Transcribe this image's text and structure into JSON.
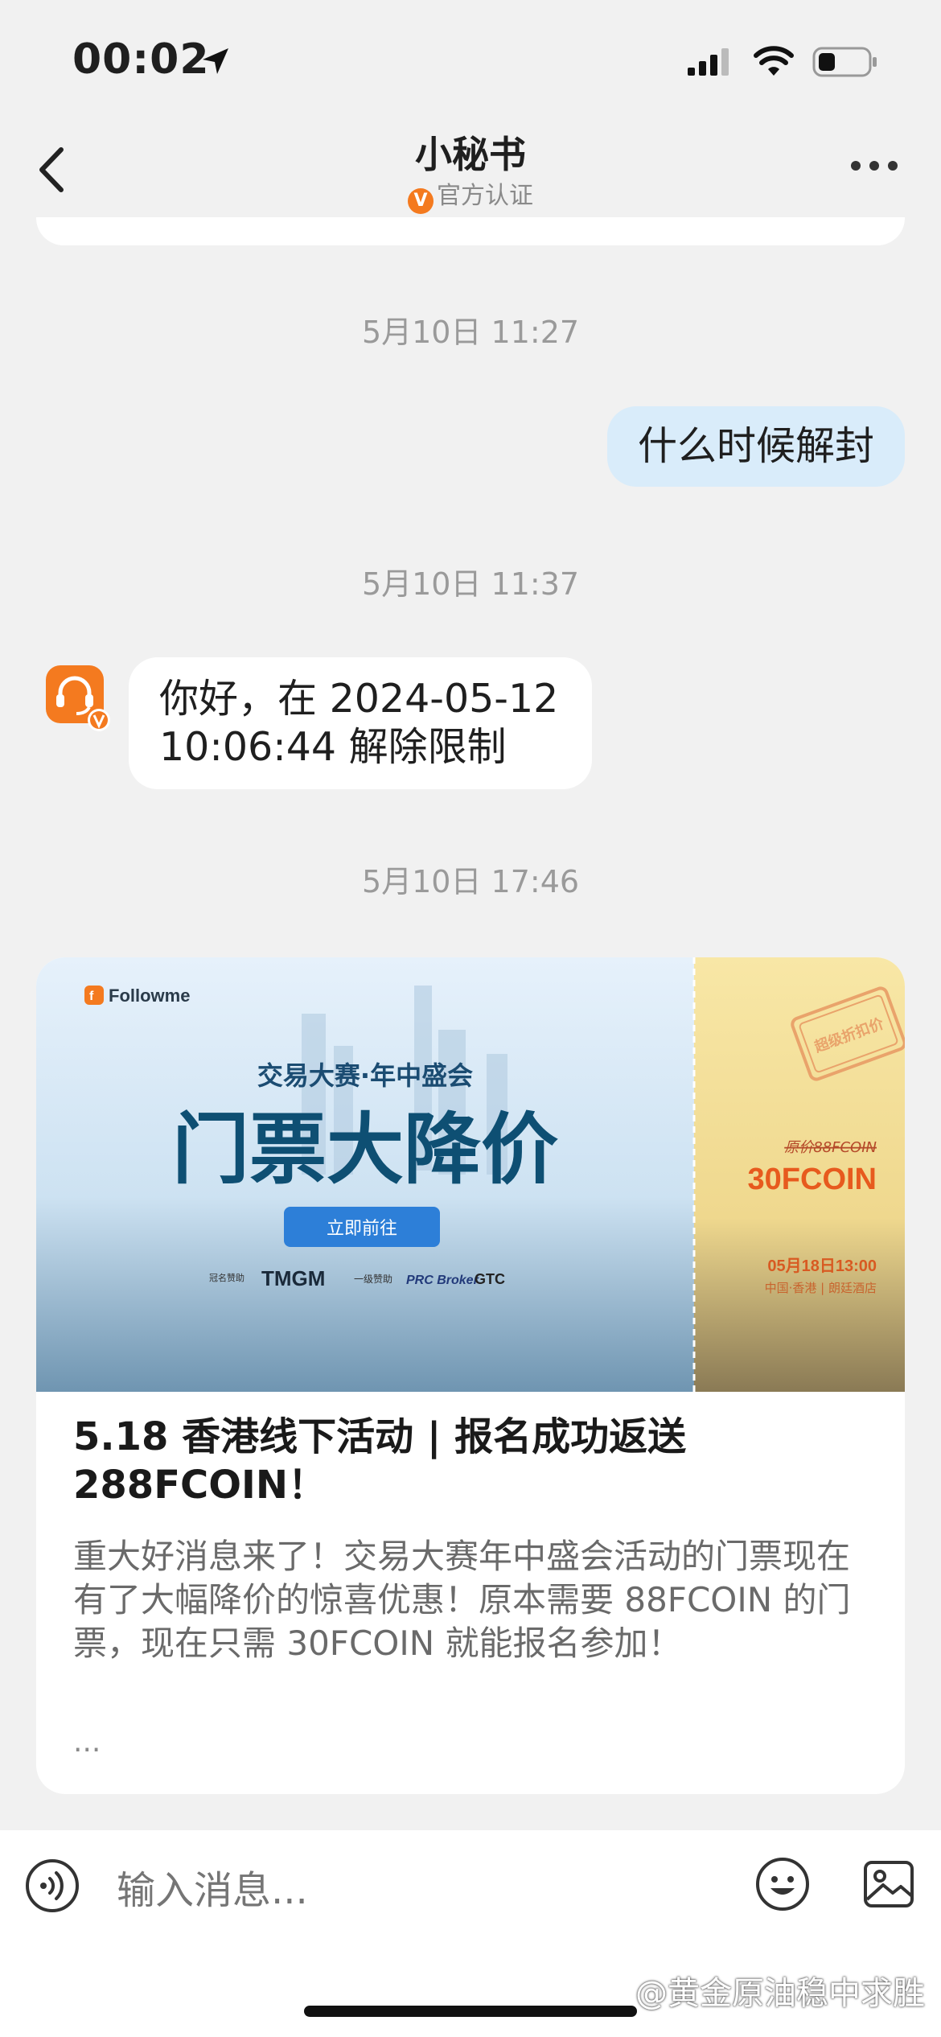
{
  "status_bar": {
    "time": "00:02"
  },
  "nav": {
    "title": "小秘书",
    "verification": "官方认证",
    "verify_badge": "V"
  },
  "chat": {
    "messages": [
      {
        "timestamp": "5月10日 11:27",
        "text": "什么时候解封",
        "direction": "outgoing"
      },
      {
        "timestamp": "5月10日 11:37",
        "text": "你好，在 2024-05-12 10:06:44 解除限制",
        "direction": "incoming"
      }
    ],
    "article": {
      "timestamp": "5月10日 17:46",
      "banner": {
        "brand": "Followme",
        "subtitle": "交易大赛·年中盛会",
        "headline": "门票大降价",
        "cta": "立即前往",
        "sponsor_label": "冠名赞助",
        "sponsor": "TMGM",
        "level_label": "一级赞助",
        "sponsor2": "PRC Broker",
        "sponsor3": "GTC",
        "stamp": "超级折扣价",
        "original_price": "原价88FCOIN",
        "new_price": "30FCOIN",
        "date": "05月18日13:00",
        "location": "中国·香港 | 朗廷酒店"
      },
      "title": "5.18 香港线下活动 | 报名成功返送 288FCOIN！",
      "description": "重大好消息来了！交易大赛年中盛会活动的门票现在有了大幅降价的惊喜优惠！原本需要 88FCOIN 的门票，现在只需 30FCOIN 就能报名参加！",
      "ellipsis": "..."
    }
  },
  "input": {
    "placeholder": "输入消息..."
  },
  "watermark": "@黄金原油稳中求胜",
  "colors": {
    "accent": "#f47a1f",
    "outgoing_bubble": "#d9ecfa",
    "background": "#f1f1f1"
  }
}
